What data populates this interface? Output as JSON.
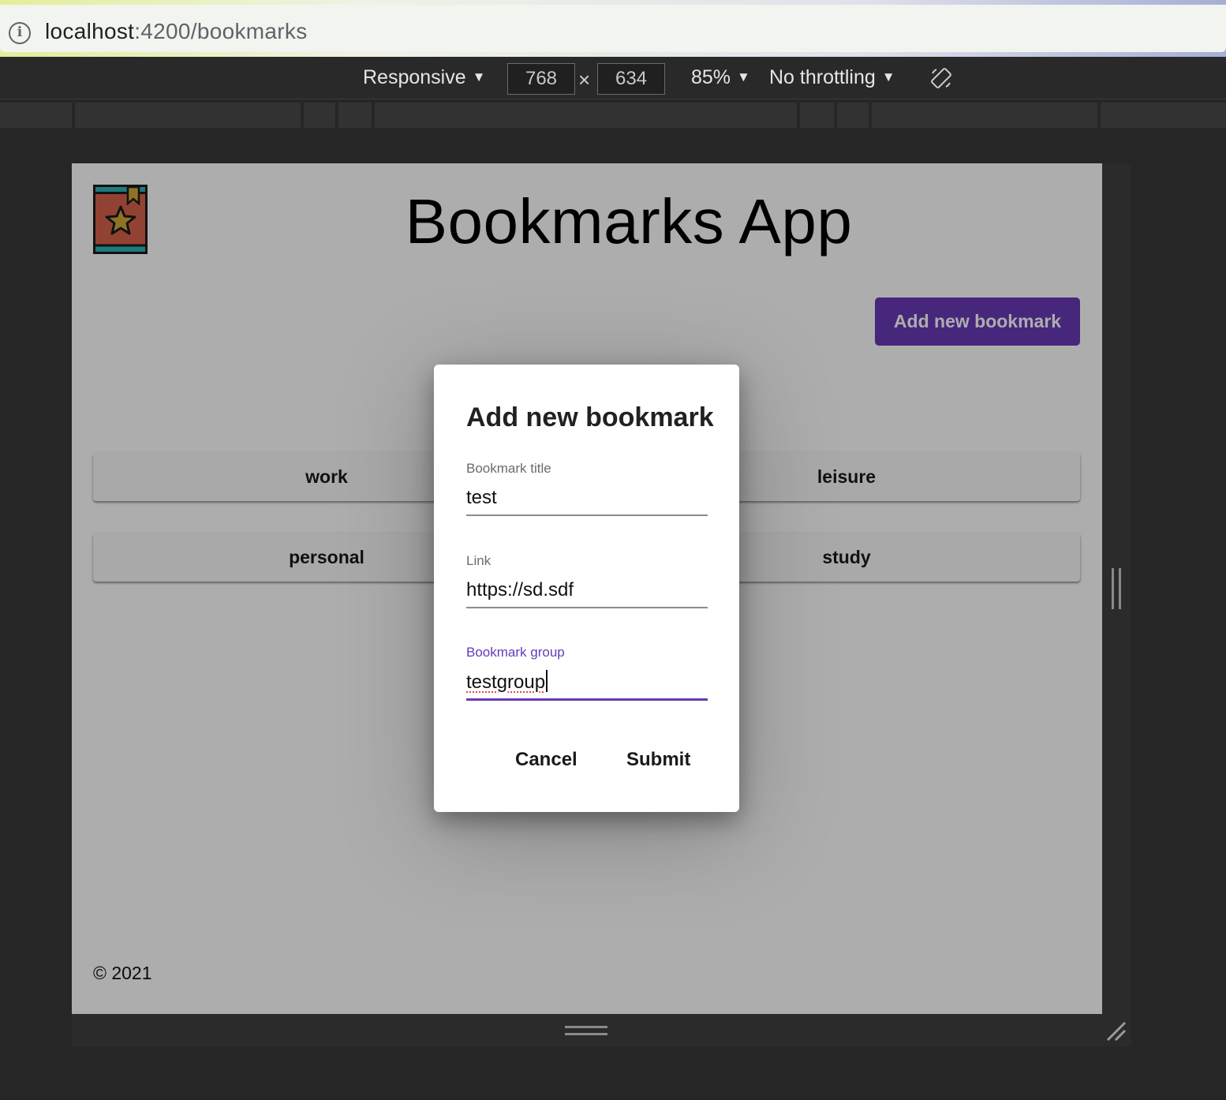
{
  "browser": {
    "url_host": "localhost",
    "url_rest": ":4200/bookmarks",
    "info_icon_glyph": "i"
  },
  "devtools": {
    "device_mode": "Responsive",
    "width": "768",
    "height": "634",
    "times": "×",
    "zoom": "85%",
    "throttling": "No throttling",
    "caret": "▼"
  },
  "app": {
    "title": "Bookmarks App",
    "add_button_label": "Add new bookmark",
    "groups": [
      "work",
      "leisure",
      "personal",
      "study"
    ],
    "footer": "© 2021",
    "colors": {
      "primary": "#673ab7",
      "logo_red": "#d8624a",
      "logo_teal": "#2bb5b8",
      "logo_star": "#d4a93a"
    }
  },
  "dialog": {
    "title": "Add new bookmark",
    "fields": [
      {
        "label": "Bookmark title",
        "value": "test"
      },
      {
        "label": "Link",
        "value": "https://sd.sdf"
      },
      {
        "label": "Bookmark group",
        "value": "testgroup"
      }
    ],
    "cancel_label": "Cancel",
    "submit_label": "Submit"
  }
}
